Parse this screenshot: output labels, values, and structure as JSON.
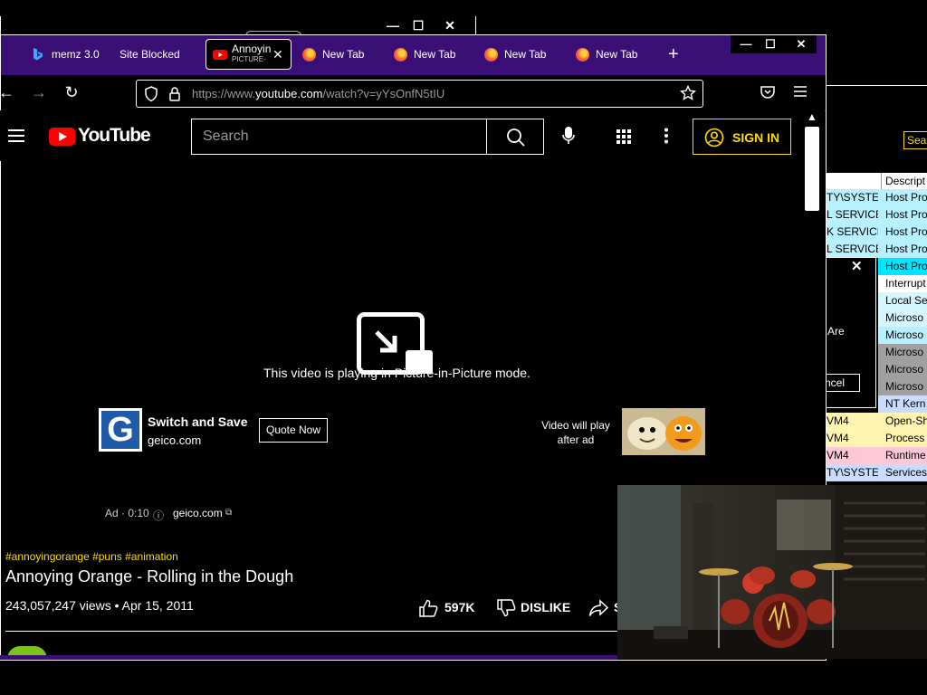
{
  "bg_window": {
    "controls": [
      "—",
      "☐",
      "✕"
    ]
  },
  "browser": {
    "window_controls": [
      "—",
      "☐",
      "✕"
    ],
    "tabs": [
      {
        "label": "memz 3.0",
        "icon": "bing-icon"
      },
      {
        "label": "Site Blocked",
        "icon": ""
      },
      {
        "label": "Annoyin",
        "sublabel": "PICTURE-",
        "icon": "youtube-icon",
        "active": true
      },
      {
        "label": "New Tab",
        "icon": "firefox-icon"
      },
      {
        "label": "New Tab",
        "icon": "firefox-icon"
      },
      {
        "label": "New Tab",
        "icon": "firefox-icon"
      },
      {
        "label": "New Tab",
        "icon": "firefox-icon"
      }
    ],
    "new_tab_label": "+",
    "url": {
      "prefix": "https://www.",
      "domain": "youtube.com",
      "path": "/watch?v=yYsOnfN5tIU"
    }
  },
  "youtube": {
    "logo_text": "YouTube",
    "search_placeholder": "Search",
    "sign_in": "SIGN IN",
    "pip_message": "This video is playing in Picture-in-Picture mode.",
    "ad": {
      "brand_letter": "G",
      "headline": "Switch and Save",
      "domain": "geico.com",
      "cta": "Quote Now",
      "next_label": "Video will play after ad",
      "next_line1": "Video will play",
      "next_line2": "after ad",
      "timer": "Ad · 0:10",
      "link": "geico.com"
    },
    "video": {
      "hashtags": "#annoyingorange #puns #animation",
      "title": "Annoying Orange - Rolling in the Dough",
      "meta": "243,057,247 views • Apr 15, 2011",
      "likes": "597K",
      "dislike": "DISLIKE",
      "share": "S"
    }
  },
  "bg_right": {
    "search": "Search",
    "columns": [
      "",
      "Descript"
    ],
    "rows": [
      {
        "a": "TY\\SYSTEM",
        "b": "Host Pro",
        "color": "#b7f0ff"
      },
      {
        "a": "L SERVICE",
        "b": "Host Pro",
        "color": "#b7f0ff"
      },
      {
        "a": "K SERVICE",
        "b": "Host Pro",
        "color": "#b7f0ff"
      },
      {
        "a": "L SERVICE",
        "b": "Host Pro",
        "color": "#b7f0ff"
      },
      {
        "a": "",
        "b": "Host Pro",
        "color": "#00e5ff"
      },
      {
        "a": "",
        "b": "Interrupt",
        "color": "#ffffff"
      },
      {
        "a": "",
        "b": "Local Se",
        "color": "#d6f6ff"
      },
      {
        "a": "",
        "b": "Microso",
        "color": "#d6f6ff"
      },
      {
        "a": "",
        "b": "Microso",
        "color": "#b7f0ff"
      },
      {
        "a": "",
        "b": "Microso",
        "color": "#a0a0a0"
      },
      {
        "a": "",
        "b": "Microso",
        "color": "#a0a0a0"
      },
      {
        "a": "",
        "b": "Microso",
        "color": "#a0a0a0"
      },
      {
        "a": "",
        "b": "NT Kern",
        "color": "#c7dcff"
      },
      {
        "a": "VM4",
        "b": "Open-Sh",
        "color": "#fff5b0"
      },
      {
        "a": "VM4",
        "b": "Process",
        "color": "#fff5b0"
      },
      {
        "a": "VM4",
        "b": "Runtime",
        "color": "#ffc8d8"
      },
      {
        "a": "TY\\SYSTEM",
        "b": "Services",
        "color": "#c7dcff"
      }
    ],
    "dialog": {
      "close": "✕",
      "text": "Are",
      "cancel": "ncel"
    }
  },
  "colors": {
    "accent_purple": "#3a0f75",
    "sign_in_yellow": "#ffdd00",
    "hashtag_yellow": "#ffdd00"
  }
}
